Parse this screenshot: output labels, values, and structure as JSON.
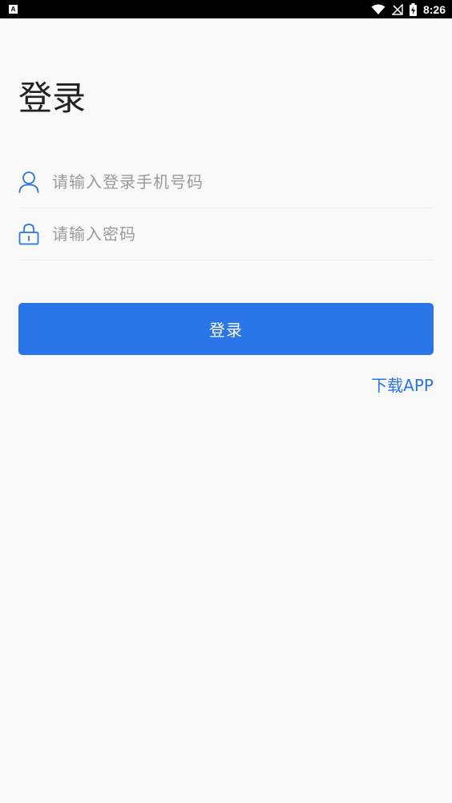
{
  "status_bar": {
    "notification_icon_letter": "A",
    "time": "8:26",
    "icons": [
      "wifi-icon",
      "no-signal-icon",
      "battery-charging-icon"
    ]
  },
  "login": {
    "title": "登录",
    "phone_placeholder": "请输入登录手机号码",
    "phone_icon": "user-icon",
    "password_placeholder": "请输入密码",
    "password_icon": "lock-icon",
    "submit_label": "登录",
    "download_label": "下载APP"
  },
  "colors": {
    "accent": "#2a75e8",
    "background": "#f9f9f9",
    "title_text": "#222222",
    "placeholder_text": "#9a9a9a"
  }
}
